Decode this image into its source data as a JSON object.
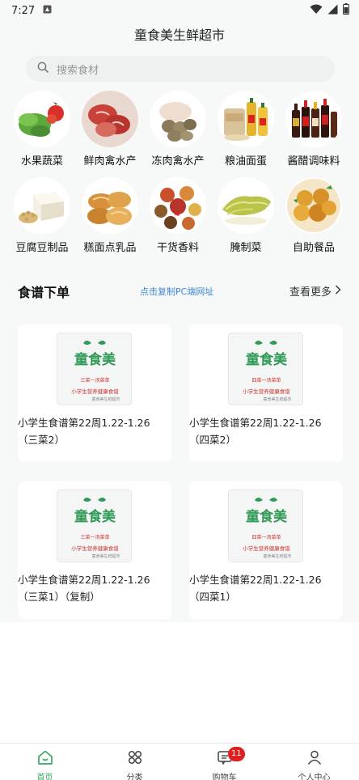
{
  "status_bar": {
    "time": "7:27"
  },
  "app": {
    "title": "童食美生鲜超市"
  },
  "search": {
    "placeholder": "搜索食材"
  },
  "categories": [
    {
      "label": "水果蔬菜",
      "icon": "vegetables-fruit-image"
    },
    {
      "label": "鲜肉禽水产",
      "icon": "fresh-meat-image"
    },
    {
      "label": "冻肉禽水产",
      "icon": "frozen-meat-image"
    },
    {
      "label": "粮油面蛋",
      "icon": "grain-oil-image"
    },
    {
      "label": "酱醋调味料",
      "icon": "sauce-condiment-image"
    },
    {
      "label": "豆腐豆制品",
      "icon": "tofu-image"
    },
    {
      "label": "糕面点乳品",
      "icon": "bakery-dairy-image"
    },
    {
      "label": "干货香料",
      "icon": "dry-spice-image"
    },
    {
      "label": "腌制菜",
      "icon": "pickled-vegetable-image"
    },
    {
      "label": "自助餐品",
      "icon": "buffet-food-image"
    }
  ],
  "recipes": {
    "title": "食谱下单",
    "link_text": "点击复制PC端网址",
    "more_text": "查看更多",
    "cards": [
      {
        "text": "小学生食谱第22周1.22-1.26（三菜2）",
        "logo_text": "童食美",
        "sub1": "三菜一汤菜单",
        "sub2": "小学生营养健康食谱",
        "sub3": "童食美生鲜超市"
      },
      {
        "text": "小学生食谱第22周1.22-1.26（四菜2）",
        "logo_text": "童食美",
        "sub1": "四菜一汤菜单",
        "sub2": "小学生营养健康食谱",
        "sub3": "童食美生鲜超市"
      },
      {
        "text": "小学生食谱第22周1.22-1.26（三菜1）（复制）",
        "logo_text": "童食美",
        "sub1": "三菜一汤菜单",
        "sub2": "小学生营养健康食谱",
        "sub3": "童食美生鲜超市"
      },
      {
        "text": "小学生食谱第22周1.22-1.26（四菜1）",
        "logo_text": "童食美",
        "sub1": "四菜一汤菜单",
        "sub2": "小学生营养健康食谱",
        "sub3": "童食美生鲜超市"
      }
    ]
  },
  "tabbar": {
    "items": [
      {
        "label": "首页",
        "icon": "home-icon",
        "active": true
      },
      {
        "label": "分类",
        "icon": "category-icon",
        "active": false
      },
      {
        "label": "购物车",
        "icon": "cart-icon",
        "active": false,
        "badge": "11"
      },
      {
        "label": "个人中心",
        "icon": "user-icon",
        "active": false
      }
    ]
  },
  "colors": {
    "accent": "#3aa860",
    "link": "#3d87d8",
    "badge": "#e02020",
    "logo_green": "#2e9a55"
  }
}
